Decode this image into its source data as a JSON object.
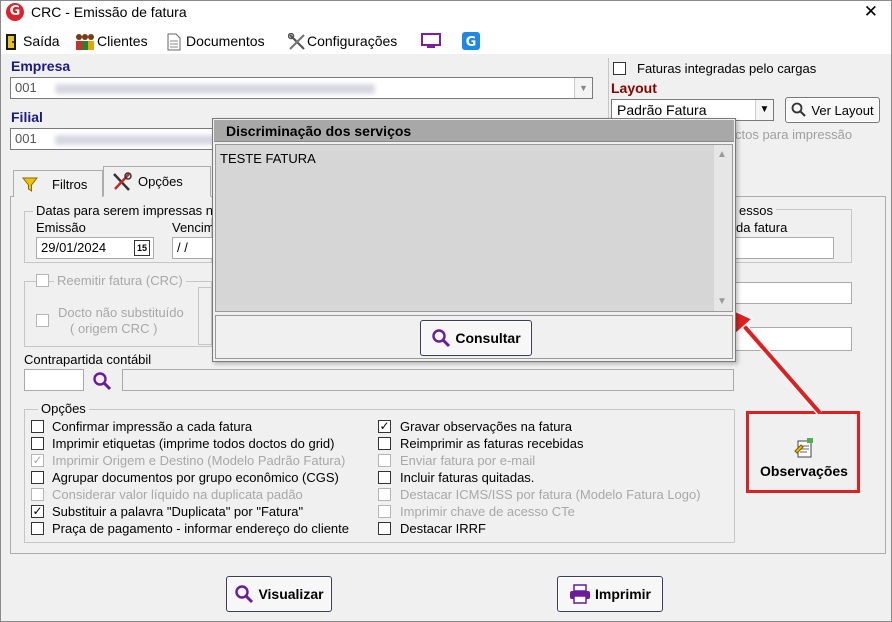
{
  "window": {
    "title": "CRC - Emissão de fatura",
    "icon_letter": "G",
    "close": "✕"
  },
  "menu": {
    "items": [
      "Saída",
      "Clientes",
      "Documentos",
      "Configurações"
    ]
  },
  "empresa": {
    "label": "Empresa",
    "code": "001"
  },
  "filial": {
    "label": "Filial",
    "code": "001"
  },
  "faturas_integradas": "Faturas integradas pelo cargas",
  "layout": {
    "label": "Layout",
    "value": "Padrão Fatura",
    "ver_layout": "Ver Layout",
    "hidden_text": "ctos para impressão"
  },
  "tabs": {
    "filtros": "Filtros",
    "opcoes": "Opções"
  },
  "datas": {
    "group_title": "Datas para serem impressas n",
    "emissao_label": "Emissão",
    "emissao_value": "29/01/2024",
    "calendar": "15",
    "vencimento_label": "Vencim",
    "vencimento_value": "/ /",
    "right_group_title": "essos",
    "right_label": "da fatura"
  },
  "reemitir": {
    "label": "Reemitir fatura (CRC)",
    "docto_line1": "Docto não substituído",
    "docto_line2": "( origem CRC )"
  },
  "contrapartida": {
    "label": "Contrapartida contábil"
  },
  "opcoes": {
    "group_title": "Opções",
    "left": [
      {
        "label": "Confirmar impressão a cada fatura",
        "checked": false,
        "disabled": false
      },
      {
        "label": "Imprimir etiquetas (imprime todos doctos do grid)",
        "checked": false,
        "disabled": false
      },
      {
        "label": "Imprimir Origem e Destino (Modelo Padrão Fatura)",
        "checked": true,
        "disabled": true
      },
      {
        "label": "Agrupar documentos por grupo econômico (CGS)",
        "checked": false,
        "disabled": false
      },
      {
        "label": "Considerar valor líquido na duplicata padão",
        "checked": false,
        "disabled": true
      },
      {
        "label": "Substituir a palavra \"Duplicata\" por \"Fatura\"",
        "checked": true,
        "disabled": false
      },
      {
        "label": "Praça de pagamento - informar endereço do cliente",
        "checked": false,
        "disabled": false
      }
    ],
    "right": [
      {
        "label": "Gravar observações na fatura",
        "checked": true,
        "disabled": false
      },
      {
        "label": "Reimprimir as faturas recebidas",
        "checked": false,
        "disabled": false
      },
      {
        "label": "Enviar fatura por e-mail",
        "checked": false,
        "disabled": true
      },
      {
        "label": "Incluir faturas quitadas.",
        "checked": false,
        "disabled": false
      },
      {
        "label": "Destacar ICMS/ISS por fatura (Modelo Fatura Logo)",
        "checked": false,
        "disabled": true
      },
      {
        "label": "Imprimir chave de acesso CTe",
        "checked": false,
        "disabled": true
      },
      {
        "label": "Destacar IRRF",
        "checked": false,
        "disabled": false
      }
    ]
  },
  "observacoes": {
    "label": "Observações"
  },
  "popup": {
    "title": "Discriminação dos serviços",
    "text": "TESTE FATURA",
    "consultar": "Consultar"
  },
  "buttons": {
    "visualizar": "Visualizar",
    "imprimir": "Imprimir"
  },
  "colors": {
    "accent_red": "#e02020",
    "label_blue": "#1a1a8a",
    "label_darkred": "#8b0000"
  }
}
